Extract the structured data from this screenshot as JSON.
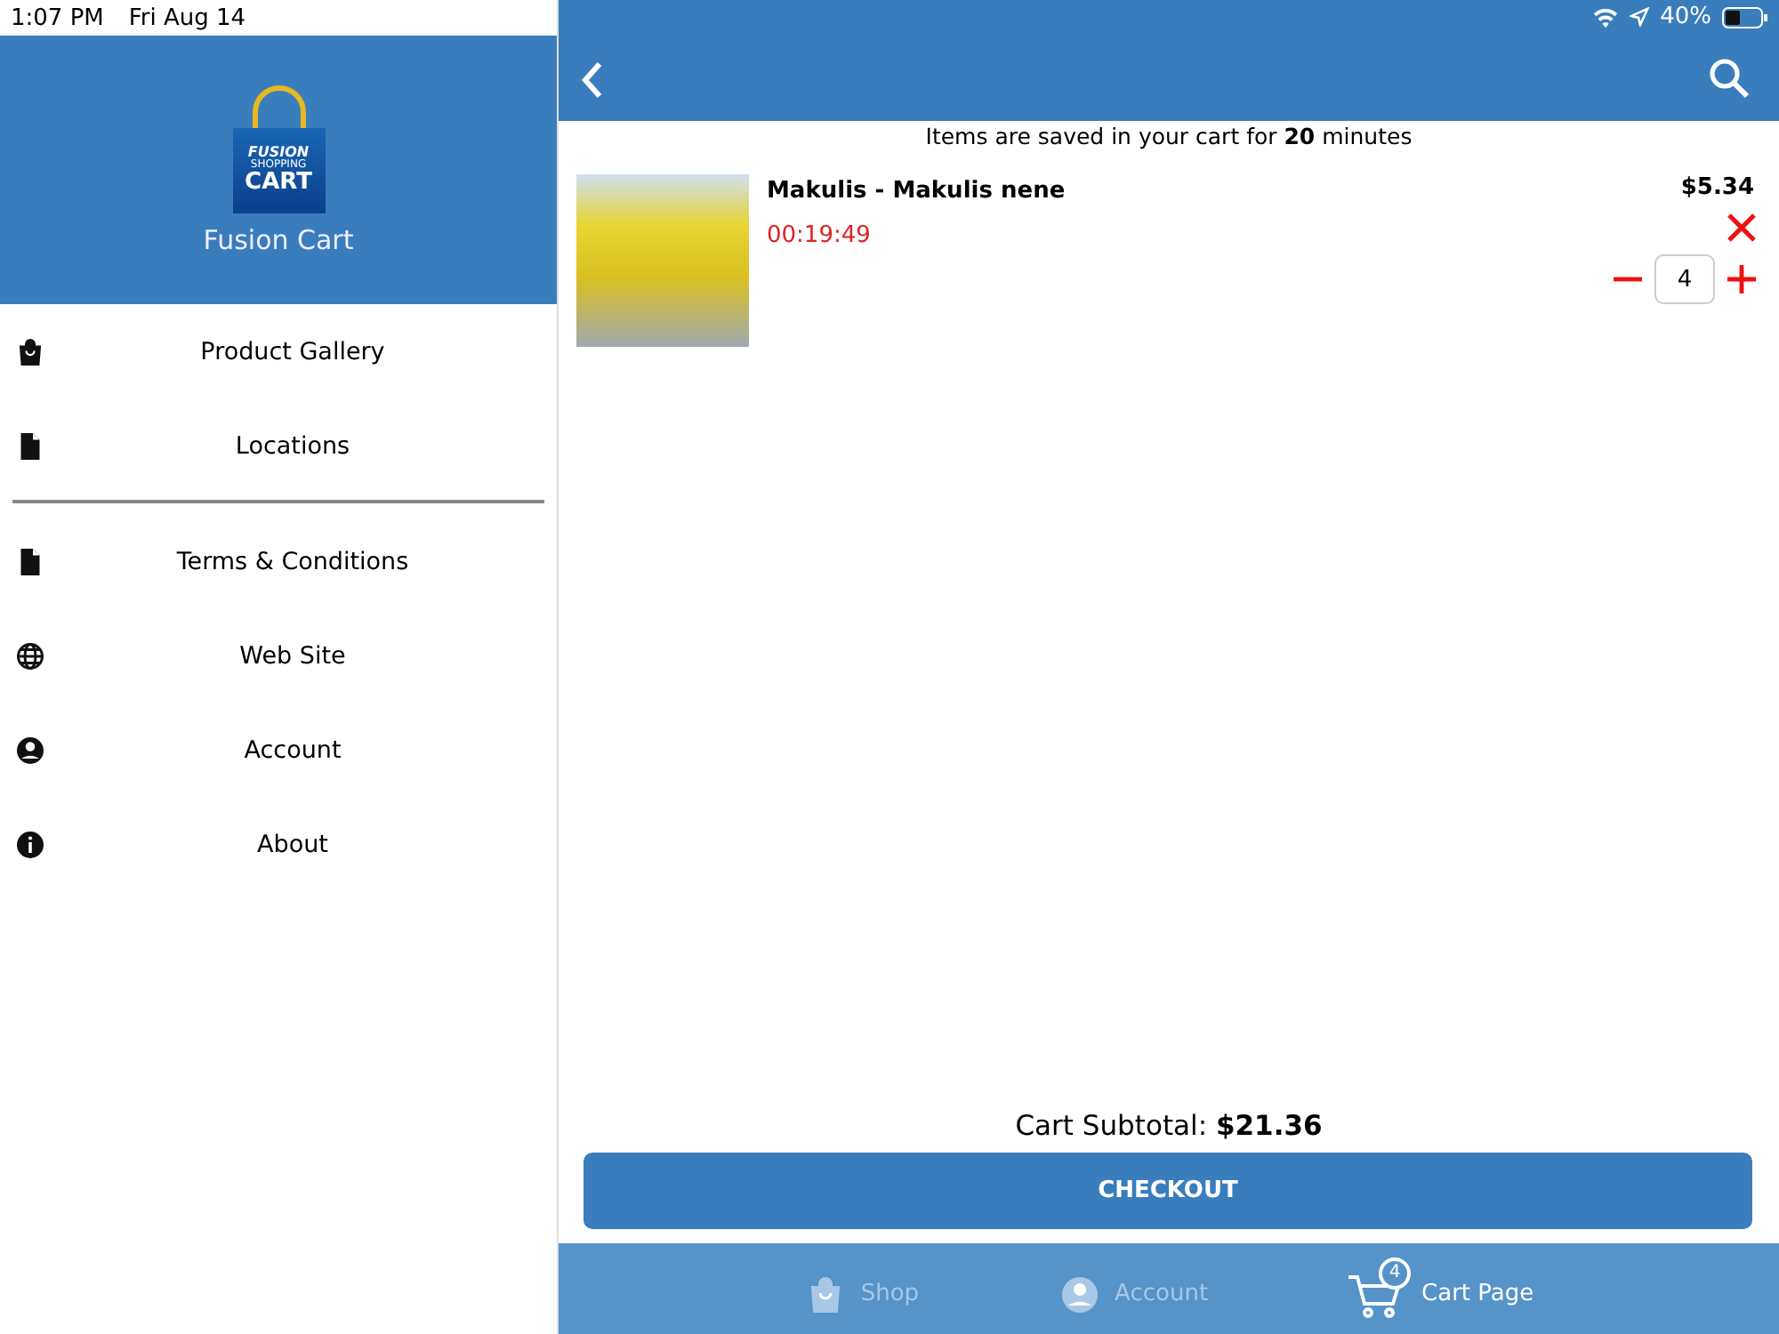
{
  "status_bar": {
    "time": "1:07 PM",
    "date": "Fri Aug 14",
    "battery": "40%"
  },
  "sidebar": {
    "logo": {
      "line_1": "FUSION",
      "line_2": "SHOPPING",
      "line_3": "CART"
    },
    "title": "Fusion Cart",
    "groups": [
      [
        {
          "label": "Product Gallery",
          "kind": "bag"
        },
        {
          "label": "Locations",
          "kind": "file"
        }
      ],
      [
        {
          "label": "Terms & Conditions",
          "kind": "file"
        },
        {
          "label": "Web Site",
          "kind": "globe"
        },
        {
          "label": "Account",
          "kind": "person"
        },
        {
          "label": "About",
          "kind": "info"
        }
      ]
    ]
  },
  "notice": "Items are saved in your cart for **20** minutes",
  "cart_items": [
    {
      "name": "Makulis - Makulis nene",
      "timer": "00:19:49",
      "price": "$5.34",
      "quantity": "4"
    }
  ],
  "subtotal": "Cart Subtotal: **$21.36**",
  "checkout": "CHECKOUT",
  "tabs": [
    {
      "label": "Shop",
      "kind": "bag",
      "selected": false
    },
    {
      "label": "Account",
      "kind": "person",
      "selected": false
    },
    {
      "label": "Cart Page",
      "kind": "cart",
      "badge": "4",
      "selected": true
    }
  ]
}
